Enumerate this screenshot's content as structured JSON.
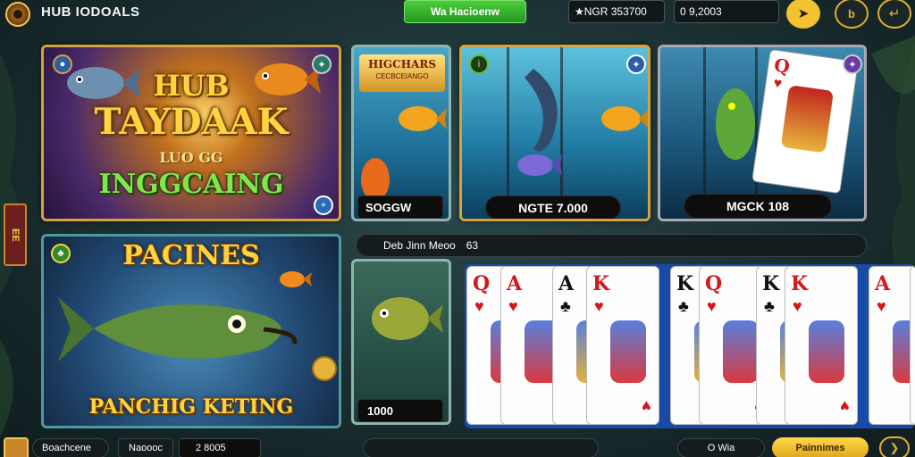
{
  "header": {
    "app_title": "HUB IODOALS",
    "promo_label": "Wa Hacioenw",
    "balance_1": "★NGR 353700",
    "balance_2": "0 9,2003"
  },
  "hero": {
    "line1": "HUB",
    "line2": "TAYDAAK",
    "line3": "LUO GG",
    "line4": "INGGCAING"
  },
  "tile_top_2": {
    "banner_1": "HIGCHARS",
    "banner_2": "CECBCEIANGO",
    "label": "SOGGW"
  },
  "tile_top_3": {
    "label": "NGTE 7.000"
  },
  "tile_top_4": {
    "label": "MGCK 108"
  },
  "fishing": {
    "title": "PACINES",
    "subtitle": "PANCHIG KETING"
  },
  "ticker": {
    "text": "Deb Jinn Meoo",
    "suffix": "63"
  },
  "fish_tile": {
    "label": "1000"
  },
  "cards": [
    {
      "rank": "Q",
      "suit": "♥",
      "color": "red"
    },
    {
      "rank": "A",
      "suit": "♥",
      "color": "red"
    },
    {
      "rank": "A",
      "suit": "♣",
      "color": "black"
    },
    {
      "rank": "K",
      "suit": "♥",
      "color": "red"
    },
    {
      "rank": "K",
      "suit": "♣",
      "color": "black"
    },
    {
      "rank": "Q",
      "suit": "♥",
      "color": "red"
    },
    {
      "rank": "K",
      "suit": "♣",
      "color": "black"
    },
    {
      "rank": "K",
      "suit": "♥",
      "color": "red"
    },
    {
      "rank": "A",
      "suit": "♥",
      "color": "red"
    },
    {
      "rank": "Q",
      "suit": "♥",
      "color": "red"
    }
  ],
  "side_tab": {
    "label": "EE"
  },
  "footer": {
    "account": "Boachcene",
    "field_2": "Naoooc",
    "field_3": "2 8005",
    "field_4": "O Wia",
    "cta": "Painnimes"
  },
  "colors": {
    "gold": "#d6a23a",
    "green": "#34b52c",
    "dark": "#0d0d0d"
  }
}
